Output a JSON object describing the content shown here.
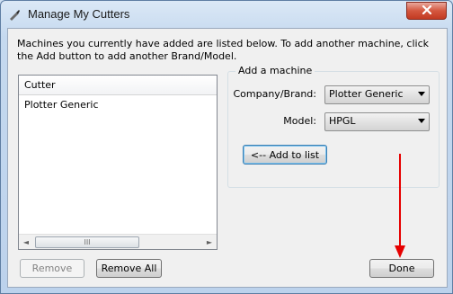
{
  "window": {
    "title": "Manage My Cutters"
  },
  "intro_text": "Machines you currently have added are listed below. To add another machine, click the Add button to add another Brand/Model.",
  "cutter_list": {
    "header": "Cutter",
    "items": [
      "Plotter Generic"
    ],
    "scrollbar_grip": "III"
  },
  "add_machine": {
    "legend": "Add a machine",
    "company_label": "Company/Brand:",
    "company_value": "Plotter Generic",
    "model_label": "Model:",
    "model_value": "HPGL",
    "add_button": "<-- Add to list"
  },
  "buttons": {
    "remove": "Remove",
    "remove_all": "Remove All",
    "done": "Done"
  },
  "colors": {
    "annotation_arrow": "#e60000",
    "close_button": "#c8402a"
  }
}
